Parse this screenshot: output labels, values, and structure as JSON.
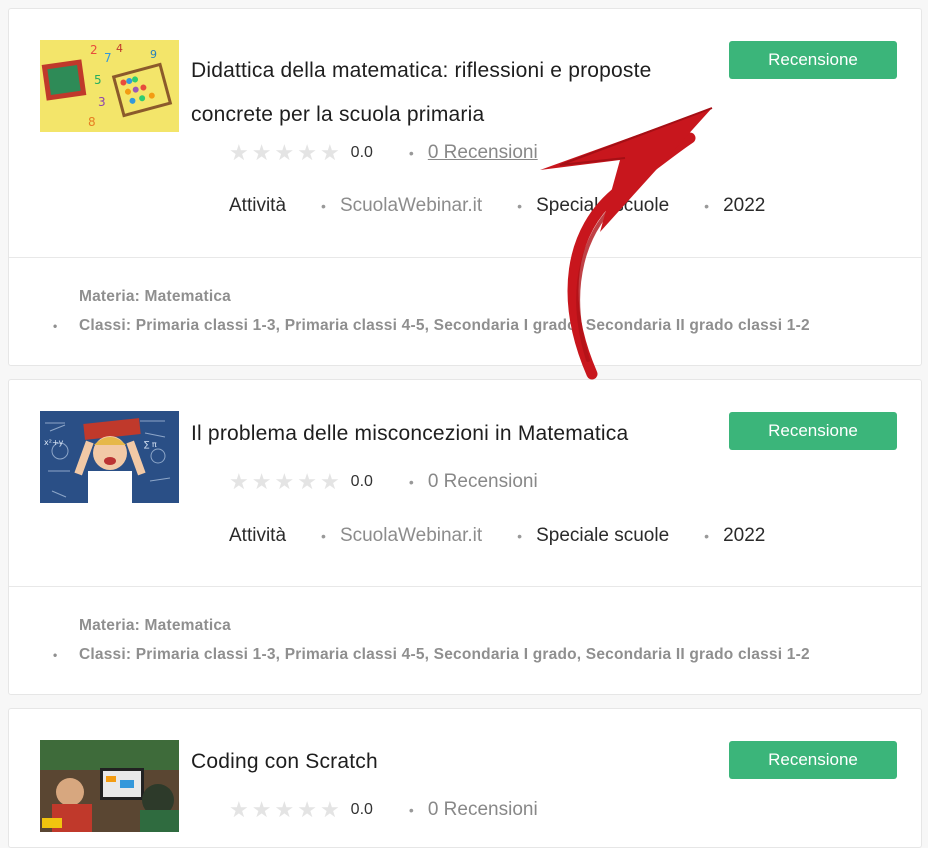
{
  "courses": [
    {
      "title": "Didattica della matematica: riflessioni e proposte concrete per la scuola primaria",
      "button": "Recensione",
      "rating": "0.0",
      "reviews": "0 Recensioni",
      "stars_filled": 0,
      "meta": {
        "type": "Attività",
        "provider": "ScuolaWebinar.it",
        "category": "Speciale scuole",
        "year": "2022"
      },
      "subject": "Materia: Matematica",
      "classes": "Classi: Primaria classi 1-3, Primaria classi 4-5, Secondaria I grado, Secondaria II grado classi 1-2"
    },
    {
      "title": "Il problema delle misconcezioni in Matematica",
      "button": "Recensione",
      "rating": "0.0",
      "reviews": "0 Recensioni",
      "stars_filled": 0,
      "meta": {
        "type": "Attività",
        "provider": "ScuolaWebinar.it",
        "category": "Speciale scuole",
        "year": "2022"
      },
      "subject": "Materia: Matematica",
      "classes": "Classi: Primaria classi 1-3, Primaria classi 4-5, Secondaria I grado, Secondaria II grado classi 1-2"
    },
    {
      "title": "Coding con Scratch",
      "button": "Recensione",
      "rating": "0.0",
      "reviews": "0 Recensioni",
      "stars_filled": 0
    }
  ],
  "colors": {
    "button": "#3bb57a",
    "arrow": "#c8161d",
    "star_empty": "#e4e4e4"
  }
}
